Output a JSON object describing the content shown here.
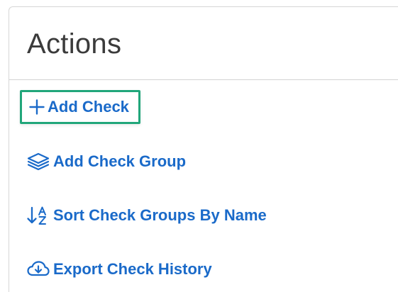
{
  "panel": {
    "title": "Actions"
  },
  "actions": [
    {
      "label": "Add Check",
      "icon": "plus-icon"
    },
    {
      "label": "Add Check Group",
      "icon": "layers-icon"
    },
    {
      "label": "Sort Check Groups By Name",
      "icon": "sort-alpha-down-icon"
    },
    {
      "label": "Export Check History",
      "icon": "cloud-download-icon"
    }
  ],
  "colors": {
    "link": "#1a6ac9",
    "focus_outline": "#21a67a",
    "title": "#3b3b3b",
    "border": "#d6d6d6"
  }
}
